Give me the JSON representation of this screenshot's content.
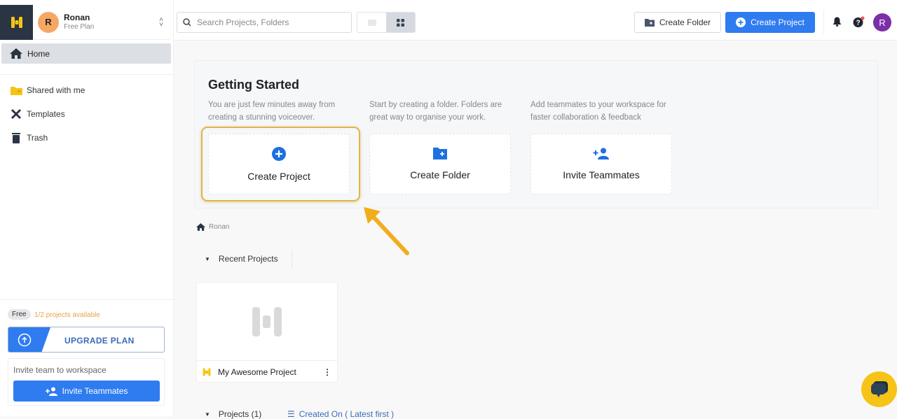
{
  "user": {
    "initial": "R",
    "name": "Ronan",
    "plan": "Free Plan"
  },
  "sidebar": {
    "home": "Home",
    "items": [
      {
        "label": "Shared with me",
        "icon": "shared-folder-icon"
      },
      {
        "label": "Templates",
        "icon": "templates-icon"
      },
      {
        "label": "Trash",
        "icon": "trash-icon"
      }
    ],
    "plan_badge": "Free",
    "projects_available": "1/2 projects available",
    "upgrade_label": "UPGRADE PLAN",
    "invite_title": "Invite team to workspace",
    "invite_button": "Invite Teammates"
  },
  "topbar": {
    "search_placeholder": "Search Projects, Folders",
    "create_folder": "Create Folder",
    "create_project": "Create Project",
    "avatar_initial": "R"
  },
  "getting_started": {
    "title": "Getting Started",
    "cards": [
      {
        "desc": "You are just few minutes away from creating a stunning voiceover.",
        "label": "Create Project",
        "icon": "plus-circle-icon"
      },
      {
        "desc": "Start by creating a folder. Folders are great way to organise your work.",
        "label": "Create Folder",
        "icon": "folder-plus-icon"
      },
      {
        "desc": "Add teammates to your workspace for faster collaboration & feedback",
        "label": "Invite Teammates",
        "icon": "add-user-icon"
      }
    ]
  },
  "breadcrumb": "Ronan",
  "recent": {
    "label": "Recent Projects",
    "projects": [
      {
        "name": "My Awesome Project"
      }
    ]
  },
  "projects": {
    "label": "Projects (1)",
    "sort": "Created On ( Latest first )"
  },
  "colors": {
    "accent": "#2f7bf0",
    "brand_yellow": "#f6c417",
    "highlight": "#e2b347"
  }
}
